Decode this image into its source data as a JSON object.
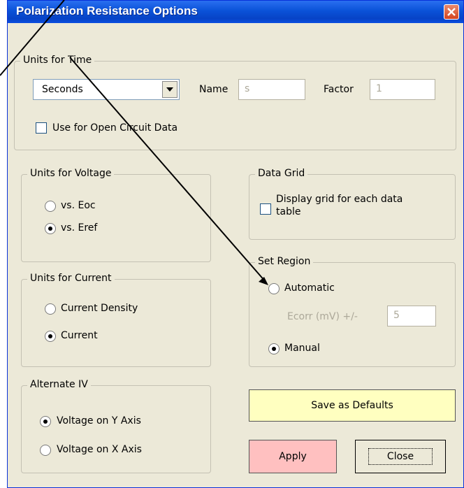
{
  "window": {
    "title": "Polarization Resistance Options"
  },
  "time_units": {
    "legend": "Units for Time",
    "selected": "Seconds",
    "name_label": "Name",
    "name_value": "s",
    "factor_label": "Factor",
    "factor_value": "1",
    "open_circuit_label": "Use for Open Circuit Data",
    "open_circuit_checked": false
  },
  "voltage_units": {
    "legend": "Units for Voltage",
    "options": [
      {
        "label": "vs. Eoc",
        "selected": false
      },
      {
        "label": "vs. Eref",
        "selected": true
      }
    ]
  },
  "current_units": {
    "legend": "Units for Current",
    "options": [
      {
        "label": "Current Density",
        "selected": false
      },
      {
        "label": "Current",
        "selected": true
      }
    ]
  },
  "alternate_iv": {
    "legend": "Alternate IV",
    "options": [
      {
        "label": "Voltage on Y Axis",
        "selected": true
      },
      {
        "label": "Voltage on X Axis",
        "selected": false
      }
    ]
  },
  "data_grid": {
    "legend": "Data Grid",
    "line1": "Display grid for each data",
    "line2": "table",
    "checked": false
  },
  "set_region": {
    "legend": "Set Region",
    "automatic_label": "Automatic",
    "ecorr_label": "Ecorr (mV) +/-",
    "ecorr_value": "5",
    "manual_label": "Manual",
    "selected": "Manual"
  },
  "buttons": {
    "save_defaults": "Save as Defaults",
    "apply": "Apply",
    "close": "Close"
  },
  "colors": {
    "title_bar": "#0a52d8",
    "dialog_bg": "#ece9d8",
    "save_defaults_bg": "#ffffc0",
    "apply_bg": "#ffc0c0"
  }
}
